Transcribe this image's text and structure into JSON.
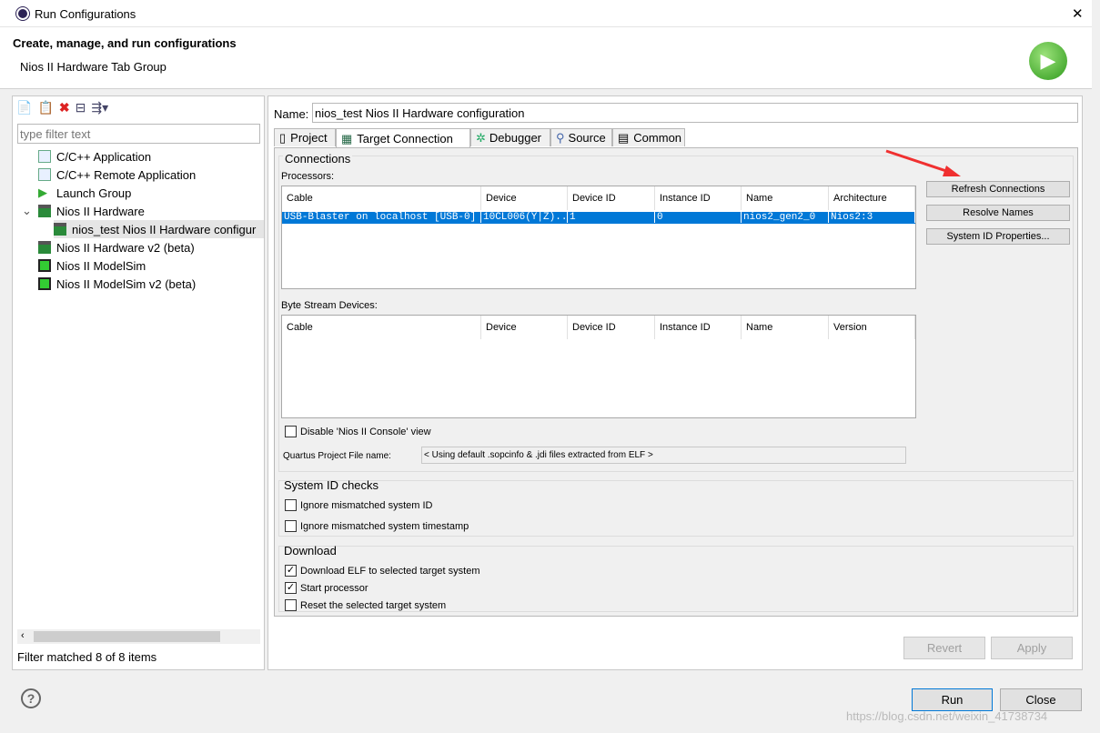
{
  "window": {
    "title": "Run Configurations",
    "close": "✕"
  },
  "header": {
    "title": "Create, manage, and run configurations",
    "subtitle": "Nios II Hardware Tab Group"
  },
  "left": {
    "filter_placeholder": "type filter text",
    "tree": [
      {
        "label": "C/C++ Application",
        "icon": "c-app-icon"
      },
      {
        "label": "C/C++ Remote Application",
        "icon": "c-app-icon"
      },
      {
        "label": "Launch Group",
        "icon": "launch-group-icon"
      },
      {
        "label": "Nios II Hardware",
        "icon": "nios-hardware-icon",
        "expanded": true
      },
      {
        "label": "nios_test Nios II Hardware configur",
        "icon": "nios-hardware-icon",
        "selected": true
      },
      {
        "label": "Nios II Hardware v2 (beta)",
        "icon": "nios-hardware-icon"
      },
      {
        "label": "Nios II ModelSim",
        "icon": "modelsim-icon"
      },
      {
        "label": "Nios II ModelSim v2 (beta)",
        "icon": "modelsim-icon"
      }
    ],
    "status": "Filter matched 8 of 8 items"
  },
  "main": {
    "name_label": "Name:",
    "name_value": "nios_test Nios II Hardware configuration",
    "tabs": [
      "Project",
      "Target Connection",
      "Debugger",
      "Source",
      "Common"
    ],
    "active_tab": "Target Connection",
    "connections": {
      "title": "Connections",
      "processors_label": "Processors:",
      "proc_columns": [
        "Cable",
        "Device",
        "Device ID",
        "Instance ID",
        "Name",
        "Architecture"
      ],
      "proc_rows": [
        [
          "USB-Blaster on localhost [USB-0]",
          "10CL006(Y|Z)...",
          "1",
          "0",
          "nios2_gen2_0",
          "Nios2:3"
        ]
      ],
      "bytestream_label": "Byte Stream Devices:",
      "bs_columns": [
        "Cable",
        "Device",
        "Device ID",
        "Instance ID",
        "Name",
        "Version"
      ],
      "buttons": [
        "Refresh Connections",
        "Resolve Names",
        "System ID Properties..."
      ],
      "disable_console": "Disable 'Nios II Console' view",
      "quartus_label": "Quartus Project File name:",
      "quartus_value": "< Using default .sopcinfo & .jdi files extracted from ELF >"
    },
    "sysid": {
      "title": "System ID checks",
      "options": [
        {
          "label": "Ignore mismatched system ID",
          "checked": false
        },
        {
          "label": "Ignore mismatched system timestamp",
          "checked": false
        }
      ]
    },
    "download": {
      "title": "Download",
      "options": [
        {
          "label": "Download ELF to selected target system",
          "checked": true
        },
        {
          "label": "Start processor",
          "checked": true
        },
        {
          "label": "Reset the selected target system",
          "checked": false
        }
      ]
    },
    "revert": "Revert",
    "apply": "Apply"
  },
  "footer": {
    "run": "Run",
    "close": "Close",
    "help": "?"
  },
  "watermark": "https://blog.csdn.net/weixin_41738734"
}
